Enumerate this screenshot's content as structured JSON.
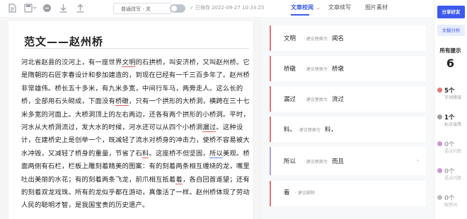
{
  "toolbar": {
    "icons": [
      "document-icon",
      "save-dropdown-icon",
      "circle-icon",
      "download-icon",
      "upload-icon"
    ],
    "mode_select": "普通改写 - 关",
    "saved_text": "已保存 2022-09-27 10:33:25"
  },
  "tabs": [
    {
      "label": "文章校阅",
      "active": true
    },
    {
      "label": "文章续写",
      "active": false
    },
    {
      "label": "图片素材",
      "active": false
    }
  ],
  "document": {
    "title": "范文——赵州桥",
    "paragraph": [
      {
        "text": "河北省赵县的洨河上，有一座世界",
        "mark": ""
      },
      {
        "text": "文明",
        "mark": "red"
      },
      {
        "text": "的石拱桥，叫安济桥，又叫赵州桥。它是隋朝的石匠李春设计和参加建造的，到现在已经有一千三百多年了。赵州桥非常雄伟。桥长五十多米，有九米多宽，中间行车马，两旁走人。这么长的桥，全部用石头砌成，下面没有",
        "mark": ""
      },
      {
        "text": "桥礅",
        "mark": "red"
      },
      {
        "text": "，只有一个拱形的大桥洞，横跨在三十七米多宽的河面上。大桥洞顶上的左右两边，还各有两个拱形的小桥洞。平时，河水从大桥洞流过，发大水的时候，河水还可以从四个小桥洞",
        "mark": ""
      },
      {
        "text": "漏过",
        "mark": "red"
      },
      {
        "text": "。这种设计，在建桥史上是创举一个，既减轻了流水对桥身的冲击力，使桥不容易被大水冲毁，又减轻了桥身的重量，节省了石",
        "mark": ""
      },
      {
        "text": "料",
        "mark": "red"
      },
      {
        "text": "。这座桥不但坚固，",
        "mark": ""
      },
      {
        "text": "所以",
        "mark": "blue"
      },
      {
        "text": "美观。桥面两侧有石栏，栏板上雕刻着精美的图案：有的刻着两条相互缠绕的龙，嘴里吐出美丽的水花；有的刻着两条飞龙，前爪相互抵着",
        "mark": ""
      },
      {
        "text": "着",
        "mark": "red"
      },
      {
        "text": "，各自回首遥望；还有的刻着双龙戏珠。所有的龙似乎都在游动，真像活了一样。赵州桥体现了劳动人民的聪明才智，是我国宝贵的历史遗产。",
        "mark": ""
      }
    ]
  },
  "suggestions": [
    {
      "original": "文明",
      "hint": "建议替换为",
      "replacement": "闻名",
      "type": "typo"
    },
    {
      "original": "桥礅",
      "hint": "建议替换为",
      "replacement": "桥墩",
      "type": "typo"
    },
    {
      "original": "漏过",
      "hint": "建议替换为",
      "replacement": "流过",
      "type": "typo"
    },
    {
      "original": "料。",
      "hint": "建议替换为",
      "replacement": "料，",
      "type": "typo"
    },
    {
      "original": "所以",
      "hint": "建议替换为",
      "replacement": "而且",
      "type": "grammar"
    },
    {
      "original": "着",
      "hint": "建议删除",
      "replacement": "",
      "type": "typo"
    }
  ],
  "sidebar": {
    "share_label": "分享好友",
    "analysis_label": "文稿分析",
    "all_label": "所有提示",
    "all_count": "6",
    "stats": [
      {
        "count": "5个",
        "label": "字词错误",
        "color": "#e57373",
        "dim": false
      },
      {
        "count": "1个",
        "label": "标点误用",
        "color": "#9e9e9e",
        "dim": false
      },
      {
        "count": "0个",
        "label": "语法问题",
        "color": "#ce93d8",
        "dim": true
      },
      {
        "count": "0个",
        "label": "语法问题",
        "color": "#ce93d8",
        "dim": true
      },
      {
        "count": "0个",
        "label": "敏感词",
        "color": "#bdbdbd",
        "dim": true
      }
    ]
  }
}
